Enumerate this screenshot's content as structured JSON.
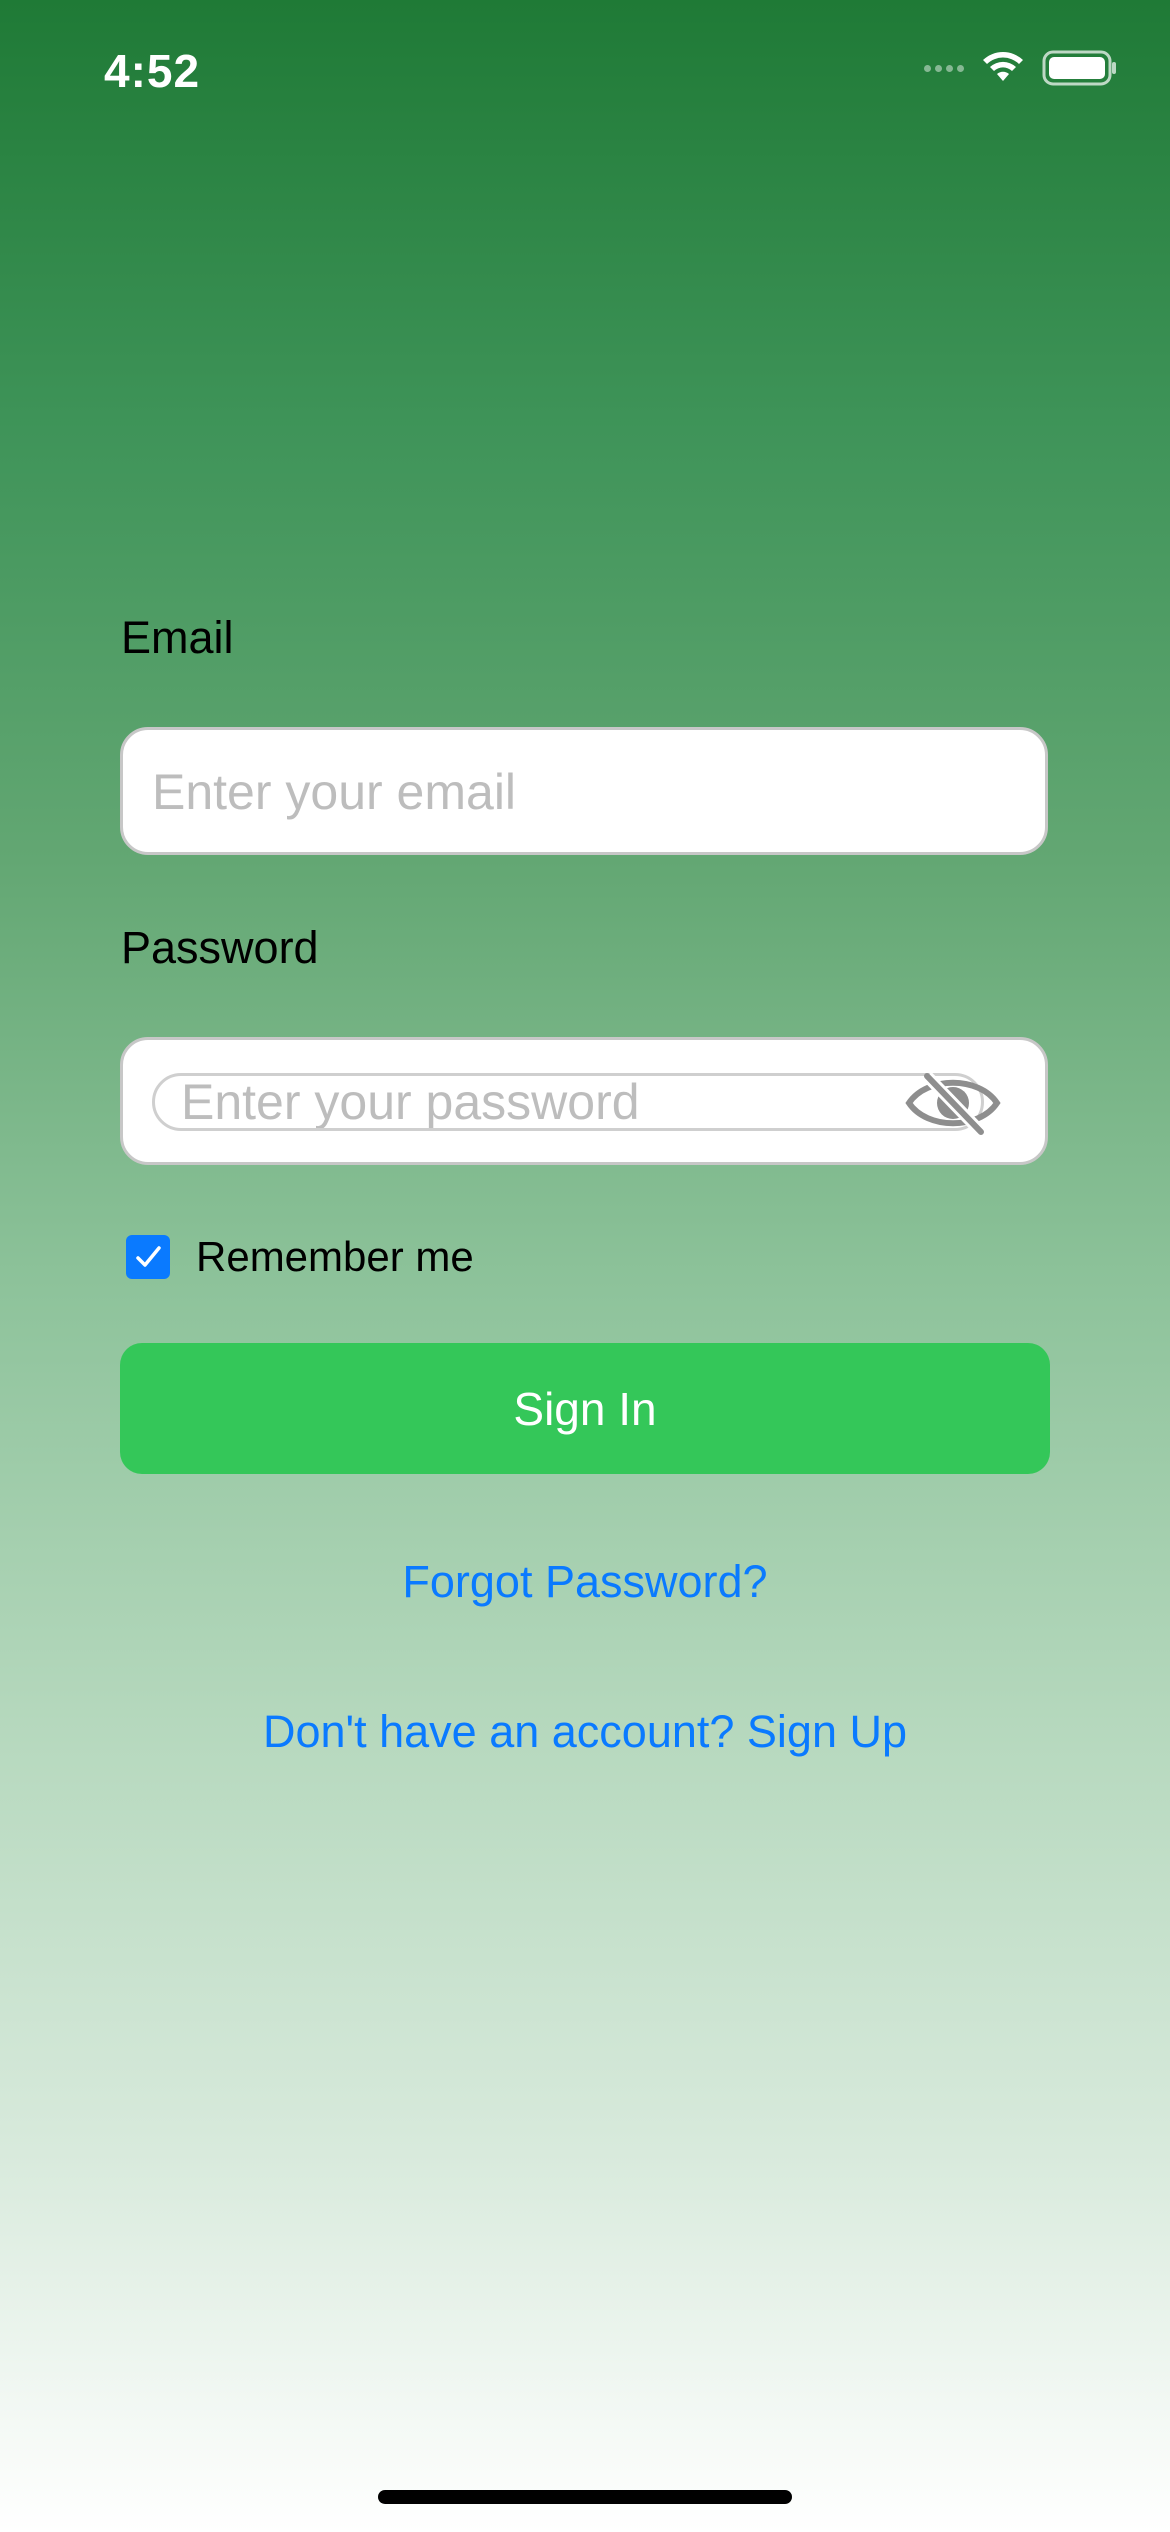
{
  "status_bar": {
    "time": "4:52",
    "icons": [
      "cellular-signal-icon",
      "wifi-icon",
      "battery-icon"
    ]
  },
  "form": {
    "email_label": "Email",
    "email_placeholder": "Enter your email",
    "email_value": "",
    "password_label": "Password",
    "password_placeholder": "Enter your password",
    "password_value": "",
    "password_visibility_icon": "eye-slash-icon",
    "remember_label": "Remember me",
    "remember_checked": true,
    "sign_in_label": "Sign In",
    "forgot_password_label": "Forgot Password?",
    "sign_up_label": "Don't have an account? Sign Up"
  },
  "colors": {
    "gradient_top": "#1f7a36",
    "gradient_bottom": "#ffffff",
    "sign_in_button": "#34c759",
    "link": "#0a7aff",
    "checkbox": "#0a7aff",
    "field_border": "#c7c7c7",
    "placeholder": "#bdbdbd"
  }
}
